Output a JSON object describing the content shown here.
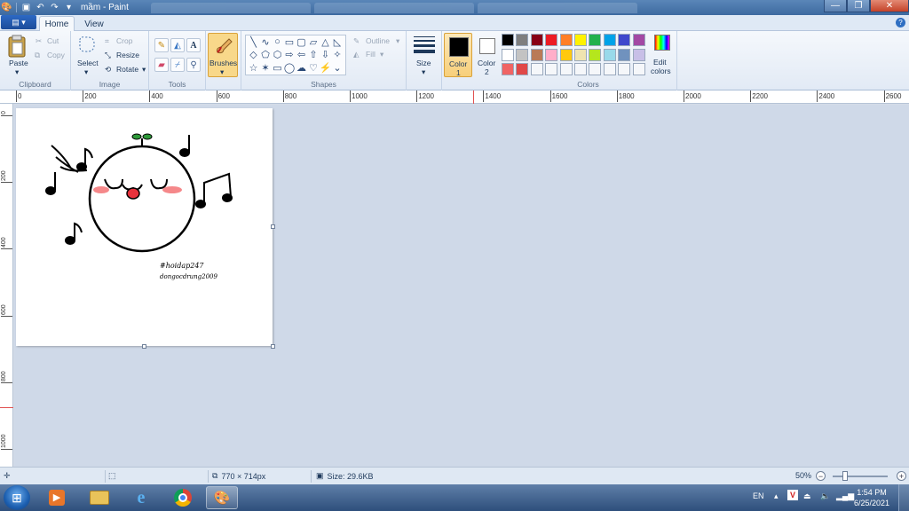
{
  "window": {
    "title": "mầm - Paint",
    "min_glyph": "—",
    "max_glyph": "❐",
    "close_glyph": "✕"
  },
  "menu": {
    "file_glyph": "▤ ▾",
    "tabs": [
      "Home",
      "View"
    ],
    "help_glyph": "?"
  },
  "ribbon": {
    "clipboard": {
      "label": "Clipboard",
      "paste": "Paste",
      "cut": "Cut",
      "copy": "Copy"
    },
    "image": {
      "label": "Image",
      "select": "Select",
      "crop": "Crop",
      "resize": "Resize",
      "rotate": "Rotate"
    },
    "tools": {
      "label": "Tools"
    },
    "brushes": {
      "label": "Brushes"
    },
    "shapes": {
      "label": "Shapes",
      "outline": "Outline",
      "fill": "Fill",
      "glyphs": [
        "╲",
        "∿",
        "○",
        "▭",
        "▢",
        "▱",
        "△",
        "◺",
        "◇",
        "⬠",
        "⬡",
        "⇨",
        "⇦",
        "⇧",
        "⇩",
        "✧",
        "☆",
        "✶",
        "▭",
        "◯",
        "☁",
        "♡",
        "⚡",
        "⌄"
      ]
    },
    "size": {
      "label": "Size"
    },
    "color1": {
      "label": "Color",
      "index": "1",
      "value": "#000000"
    },
    "color2": {
      "label": "Color",
      "index": "2",
      "value": "#ffffff"
    },
    "colors": {
      "label": "Colors",
      "edit": "Edit",
      "edit2": "colors",
      "palette": [
        "#000000",
        "#7f7f7f",
        "#880015",
        "#ed1c24",
        "#ff7f27",
        "#fff200",
        "#22b14c",
        "#00a2e8",
        "#3f48cc",
        "#a349a4",
        "#ffffff",
        "#c3c3c3",
        "#b97a57",
        "#ffaec9",
        "#ffc90e",
        "#efe4b0",
        "#b5e61d",
        "#99d9ea",
        "#7092be",
        "#c8bfe7",
        "#f06464",
        "#e04848",
        "#f5f7fa",
        "#f5f7fa",
        "#f5f7fa",
        "#f5f7fa",
        "#f5f7fa",
        "#f5f7fa",
        "#f5f7fa",
        "#f5f7fa"
      ]
    }
  },
  "ruler": {
    "h_ticks": [
      "0",
      "200",
      "400",
      "600",
      "800",
      "1000",
      "1200",
      "1400",
      "1600",
      "1800",
      "2000",
      "2200",
      "2400",
      "2600"
    ],
    "v_ticks": [
      "0",
      "200",
      "400",
      "600",
      "800",
      "1000"
    ]
  },
  "drawing": {
    "text_line1": "#hoidap247",
    "text_line2": "dongocdrung2009"
  },
  "status": {
    "dimensions": "770 × 714px",
    "size": "Size: 29.6KB",
    "zoom": "50%",
    "zoom_percent": 50
  },
  "taskbar": {
    "lang": "EN",
    "time": "1:54 PM",
    "date": "6/25/2021"
  },
  "colors": {
    "accent": "#2f6fc2",
    "brushes_active": "#f8d88a"
  }
}
